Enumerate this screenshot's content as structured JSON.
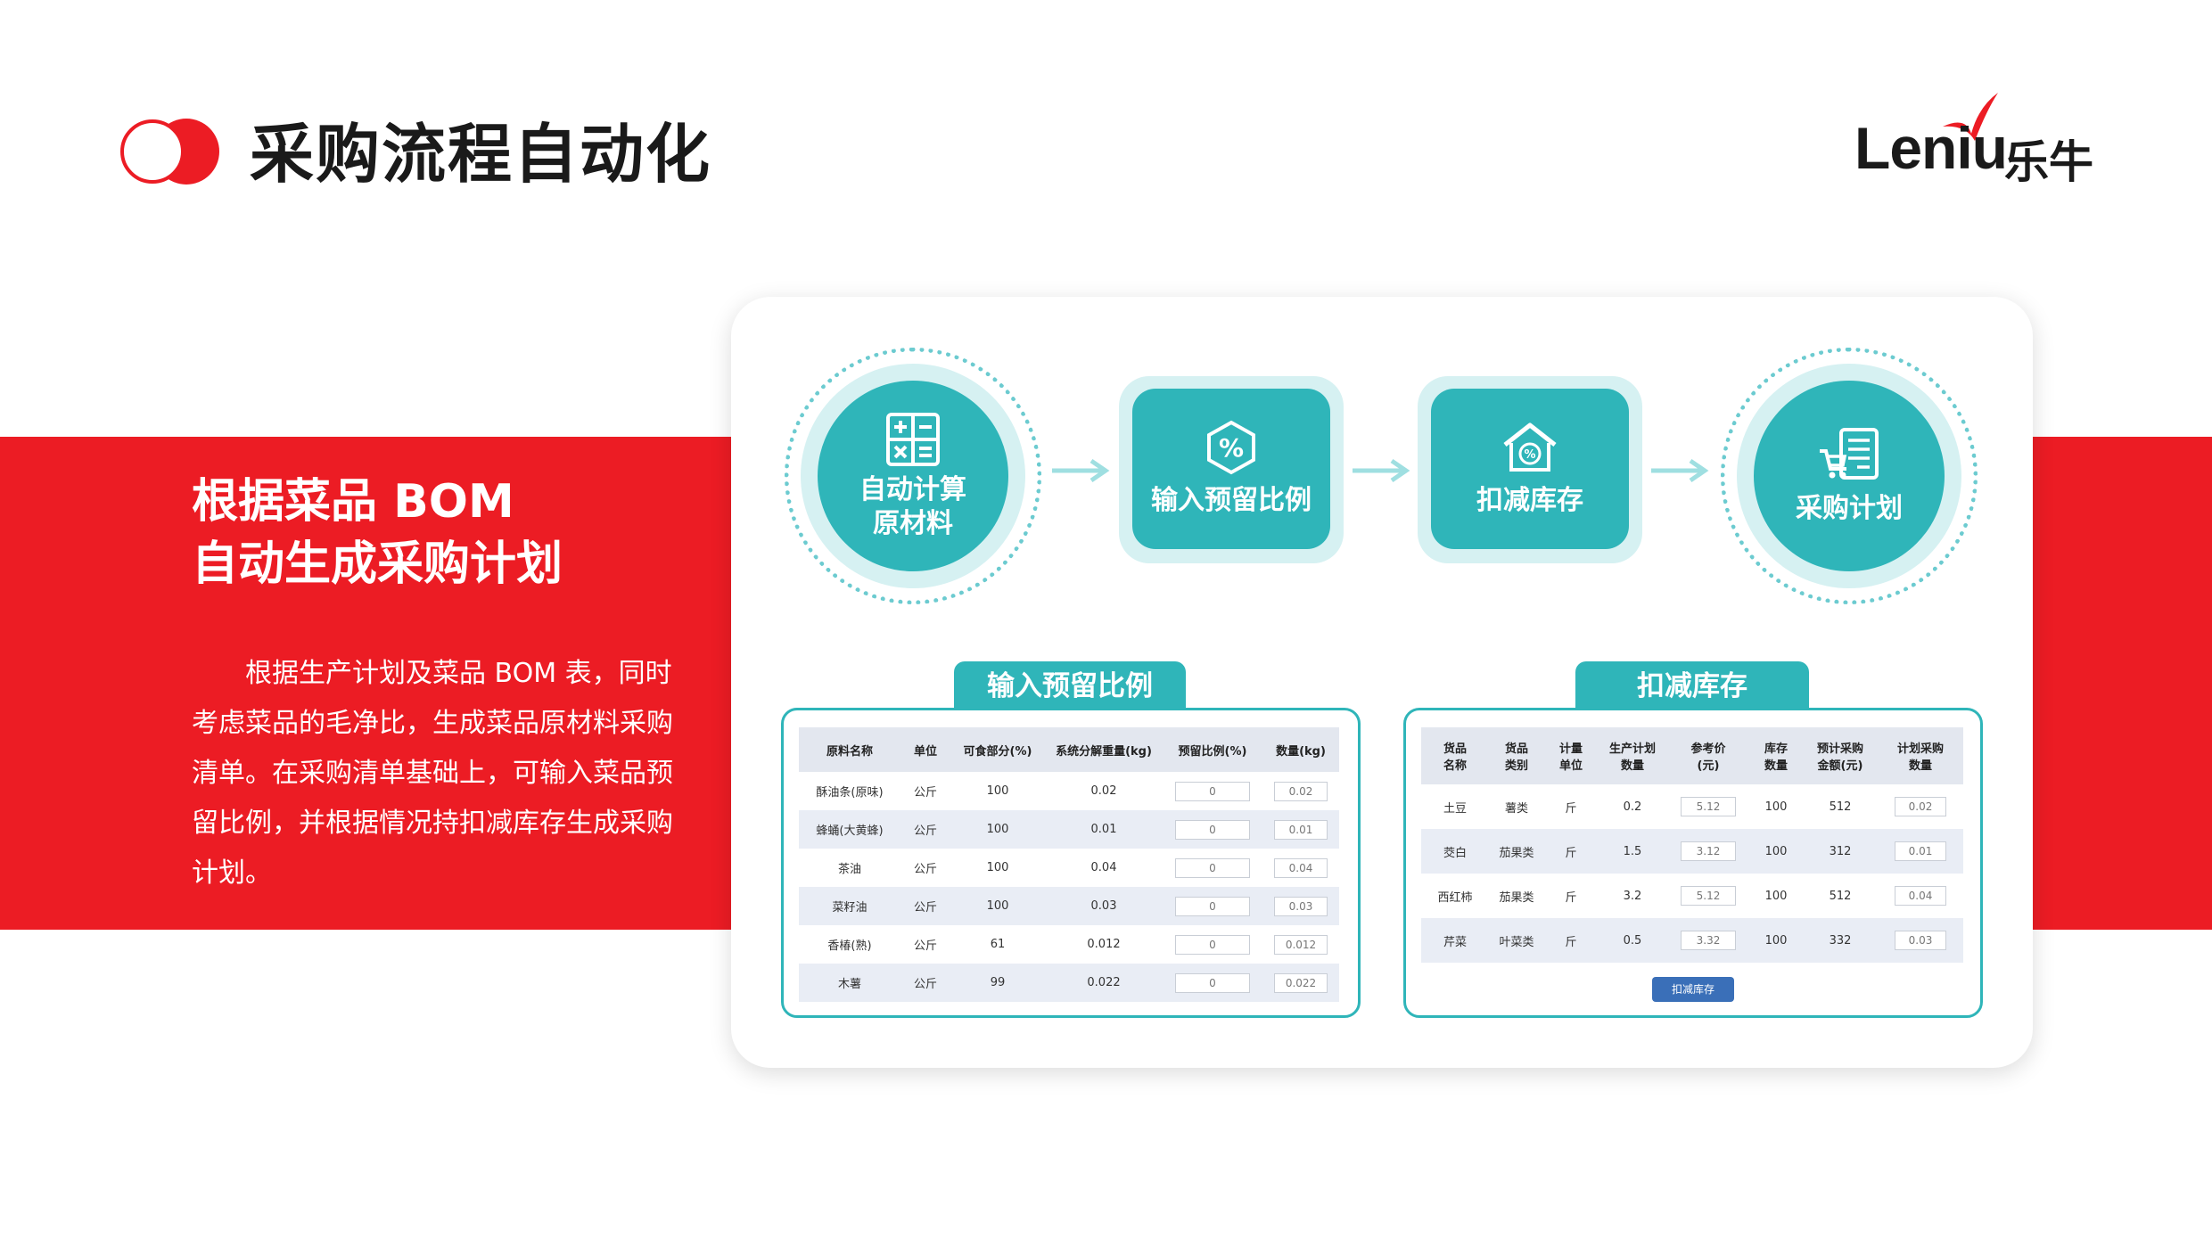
{
  "header": {
    "title": "采购流程自动化",
    "brand_latin": "Leniu",
    "brand_cn": "乐牛",
    "accent_color": "#ec1c24",
    "teal_color": "#2fb5b9"
  },
  "intro": {
    "heading_line1": "根据菜品 BOM",
    "heading_line2": "自动生成采购计划",
    "body": "根据生产计划及菜品 BOM 表，同时考虑菜品的毛净比，生成菜品原材料采购清单。在采购清单基础上，可输入菜品预留比例，并根据情况持扣减库存生成采购计划。"
  },
  "flow": {
    "steps": [
      {
        "label_line1": "自动计算",
        "label_line2": "原材料",
        "icon": "calculator-icon"
      },
      {
        "label_line1": "输入预留比例",
        "label_line2": "",
        "icon": "percent-icon"
      },
      {
        "label_line1": "扣减库存",
        "label_line2": "",
        "icon": "warehouse-icon"
      },
      {
        "label_line1": "采购计划",
        "label_line2": "",
        "icon": "shopping-list-icon"
      }
    ]
  },
  "reserve_panel": {
    "tab": "输入预留比例",
    "columns": [
      "原料名称",
      "单位",
      "可食部分(%)",
      "系统分解重量(kg)",
      "预留比例(%)",
      "数量(kg)"
    ],
    "rows": [
      {
        "name": "酥油条(原味)",
        "unit": "公斤",
        "edible": "100",
        "weight": "0.02",
        "ratio": "0",
        "qty": "0.02"
      },
      {
        "name": "蜂蛹(大黄蜂)",
        "unit": "公斤",
        "edible": "100",
        "weight": "0.01",
        "ratio": "0",
        "qty": "0.01"
      },
      {
        "name": "茶油",
        "unit": "公斤",
        "edible": "100",
        "weight": "0.04",
        "ratio": "0",
        "qty": "0.04"
      },
      {
        "name": "菜籽油",
        "unit": "公斤",
        "edible": "100",
        "weight": "0.03",
        "ratio": "0",
        "qty": "0.03"
      },
      {
        "name": "香椿(熟)",
        "unit": "公斤",
        "edible": "61",
        "weight": "0.012",
        "ratio": "0",
        "qty": "0.012"
      },
      {
        "name": "木薯",
        "unit": "公斤",
        "edible": "99",
        "weight": "0.022",
        "ratio": "0",
        "qty": "0.022"
      }
    ]
  },
  "stock_panel": {
    "tab": "扣减库存",
    "columns": [
      [
        "货品",
        "名称"
      ],
      [
        "货品",
        "类别"
      ],
      [
        "计量",
        "单位"
      ],
      [
        "生产计划",
        "数量"
      ],
      [
        "参考价",
        "(元)"
      ],
      [
        "库存",
        "数量"
      ],
      [
        "预计采购",
        "金额(元)"
      ],
      [
        "计划采购",
        "数量"
      ]
    ],
    "rows": [
      {
        "name": "土豆",
        "category": "薯类",
        "unit": "斤",
        "plan": "0.2",
        "price": "5.12",
        "stock": "100",
        "amount": "512",
        "purchase": "0.02"
      },
      {
        "name": "茭白",
        "category": "茄果类",
        "unit": "斤",
        "plan": "1.5",
        "price": "3.12",
        "stock": "100",
        "amount": "312",
        "purchase": "0.01"
      },
      {
        "name": "西红柿",
        "category": "茄果类",
        "unit": "斤",
        "plan": "3.2",
        "price": "5.12",
        "stock": "100",
        "amount": "512",
        "purchase": "0.04"
      },
      {
        "name": "芹菜",
        "category": "叶菜类",
        "unit": "斤",
        "plan": "0.5",
        "price": "3.32",
        "stock": "100",
        "amount": "332",
        "purchase": "0.03"
      }
    ],
    "button": "扣减库存"
  }
}
